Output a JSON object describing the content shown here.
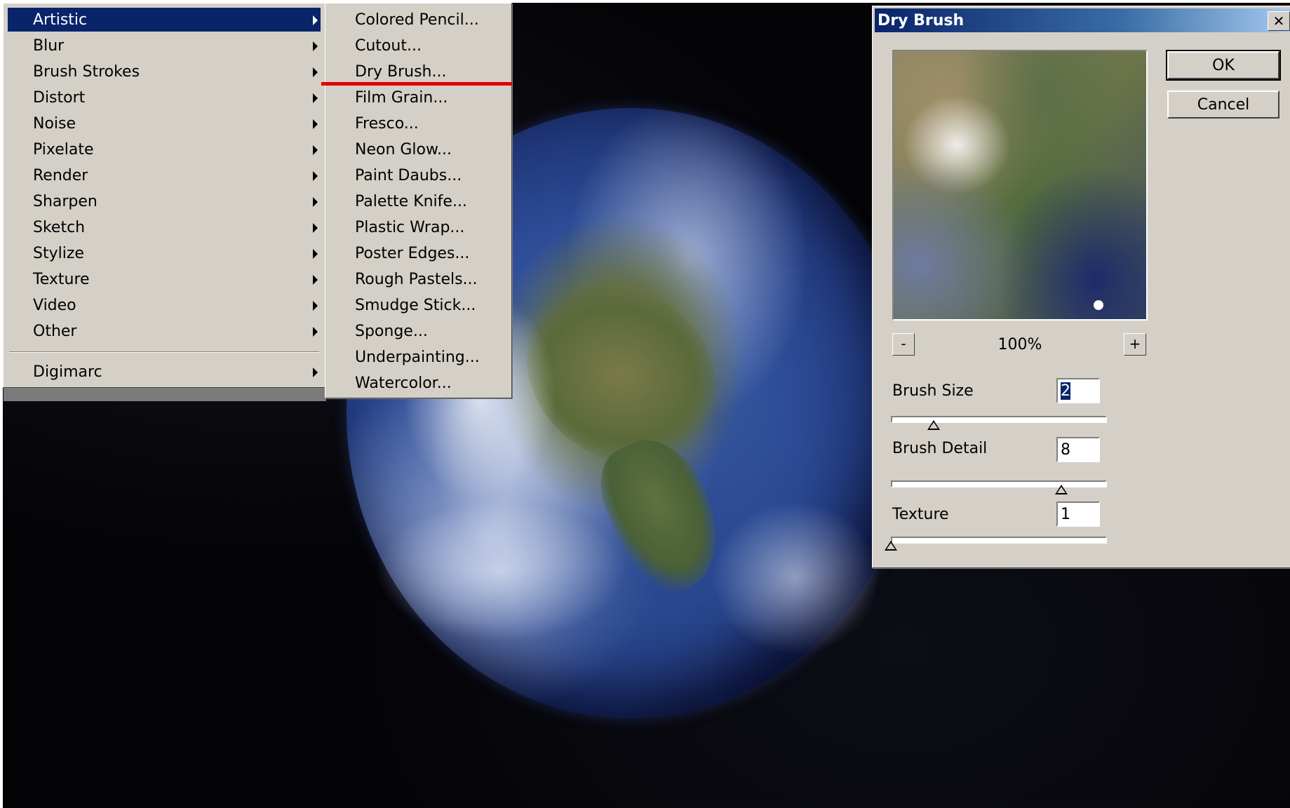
{
  "main_menu": {
    "items": [
      {
        "label": "Artistic",
        "selected": true
      },
      {
        "label": "Blur"
      },
      {
        "label": "Brush Strokes"
      },
      {
        "label": "Distort"
      },
      {
        "label": "Noise"
      },
      {
        "label": "Pixelate"
      },
      {
        "label": "Render"
      },
      {
        "label": "Sharpen"
      },
      {
        "label": "Sketch"
      },
      {
        "label": "Stylize"
      },
      {
        "label": "Texture"
      },
      {
        "label": "Video"
      },
      {
        "label": "Other"
      }
    ],
    "extra_item": "Digimarc"
  },
  "sub_menu": {
    "items": [
      "Colored Pencil...",
      "Cutout...",
      "Dry Brush...",
      "Film Grain...",
      "Fresco...",
      "Neon Glow...",
      "Paint Daubs...",
      "Palette Knife...",
      "Plastic Wrap...",
      "Poster Edges...",
      "Rough Pastels...",
      "Smudge Stick...",
      "Sponge...",
      "Underpainting...",
      "Watercolor..."
    ],
    "highlighted": "Dry Brush..."
  },
  "dialog": {
    "title": "Dry Brush",
    "close_glyph": "✕",
    "ok_label": "OK",
    "cancel_label": "Cancel",
    "zoom_out_glyph": "-",
    "zoom_in_glyph": "+",
    "zoom_level": "100%",
    "params": [
      {
        "label": "Brush Size",
        "value": "2",
        "slider_fraction": 0.2
      },
      {
        "label": "Brush Detail",
        "value": "8",
        "slider_fraction": 0.8
      },
      {
        "label": "Texture",
        "value": "1",
        "slider_fraction": 0.0
      }
    ]
  },
  "colors": {
    "menu_bg": "#d4d0c8",
    "selection": "#0a246a",
    "highlight_line": "#e00000"
  }
}
